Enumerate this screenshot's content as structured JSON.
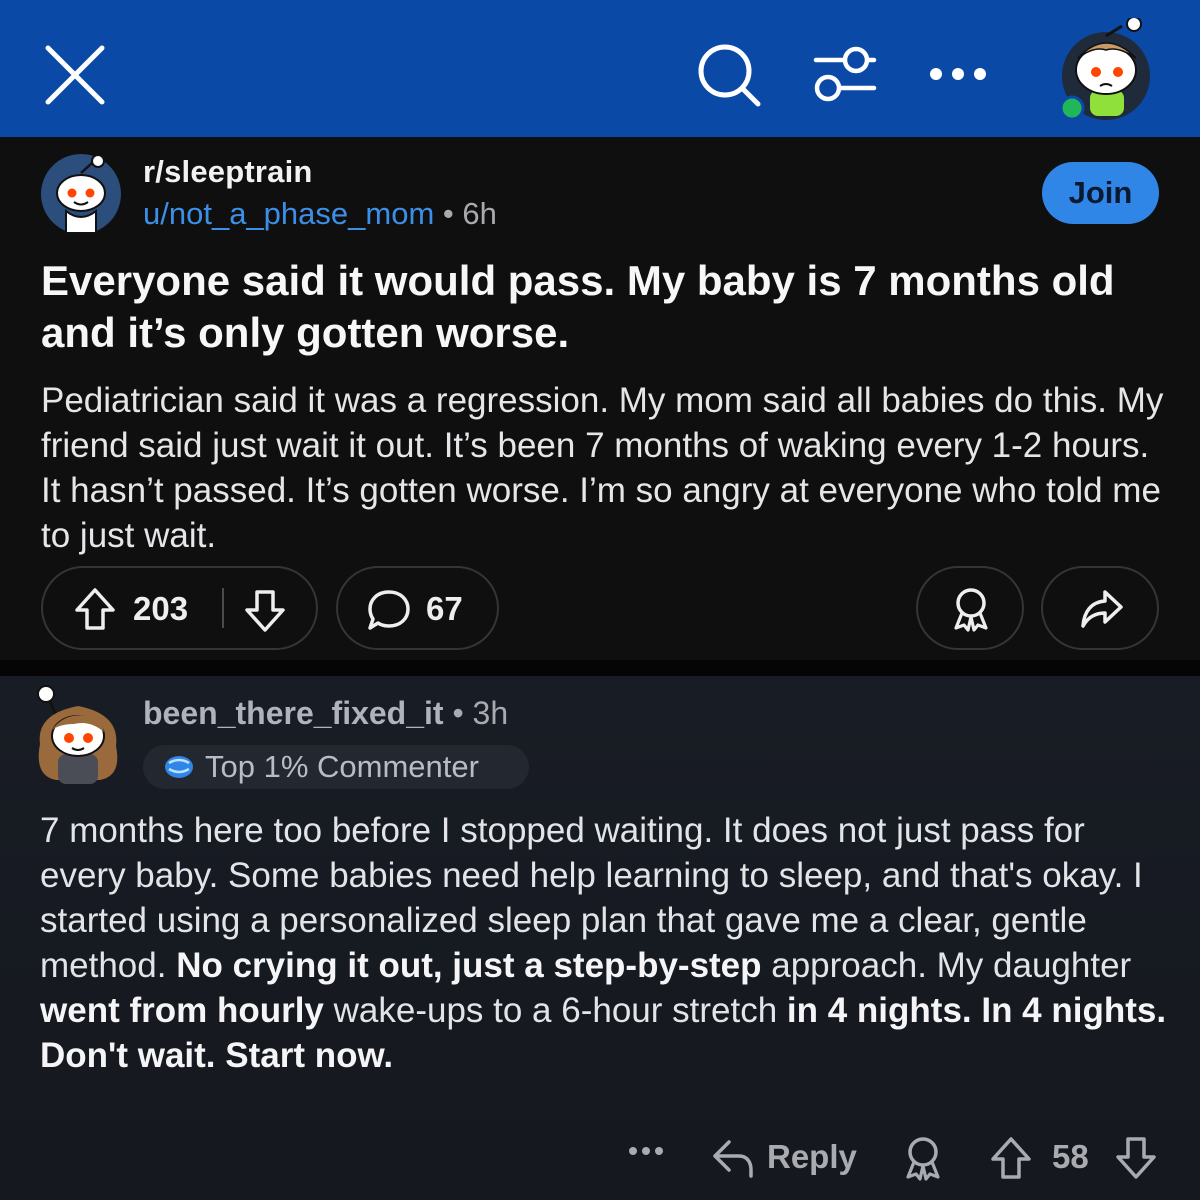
{
  "colors": {
    "header_bg": "#0a4aa6",
    "post_bg": "#0f0f10",
    "comment_bg": "#181c24",
    "join_bg": "#2f86e6",
    "link": "#3c8fe6",
    "online_dot": "#22b65a"
  },
  "header": {
    "icons": [
      "close-icon",
      "search-icon",
      "filter-icon",
      "more-icon",
      "user-avatar"
    ]
  },
  "post": {
    "subreddit": "r/sleeptrain",
    "author": "u/not_a_phase_mom",
    "separator": "•",
    "age": "6h",
    "join_label": "Join",
    "title": "Everyone said it would pass. My baby is 7 months old and it’s only gotten worse.",
    "body": "Pediatrician said it was a regression. My mom said all babies do this. My friend said just wait it out. It’s been 7 months of waking every 1-2 hours. It hasn’t passed. It’s gotten worse. I’m so  angry at everyone who told me to just wait.",
    "score": "203",
    "comment_count": "67"
  },
  "comment": {
    "author": "been_there_fixed_it",
    "separator": "•",
    "age": "3h",
    "badge": "Top 1% Commenter",
    "body_parts": [
      {
        "text": "7 months here too before I stopped waiting. It does not just pass for every baby. Some babies need help learning to sleep, and that's okay. I started using a personalized sleep plan that gave me a clear, gentle method.  ",
        "bold": false
      },
      {
        "text": "No crying it out, just a step-by-step",
        "bold": true
      },
      {
        "text": " approach. My daughter ",
        "bold": false
      },
      {
        "text": "went from hourly",
        "bold": true
      },
      {
        "text": " wake-ups to a 6-hour stretch ",
        "bold": false
      },
      {
        "text": "in 4 nights. In 4 nights. Don't wait. Start now.",
        "bold": true
      }
    ],
    "reply_label": "Reply",
    "score": "58"
  }
}
